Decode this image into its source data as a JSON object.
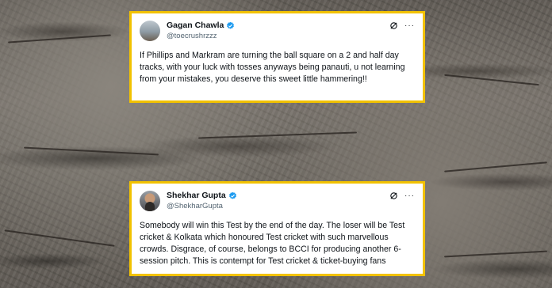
{
  "tweets": [
    {
      "name": "Gagan Chawla",
      "handle": "@toecrushrzzz",
      "text": "If Phillips and Markram are turning the ball square on a 2 and half day tracks, with your luck with tosses anyways being panauti, u not learning from your mistakes, you deserve this sweet little hammering!!"
    },
    {
      "name": "Shekhar Gupta",
      "handle": "@ShekharGupta",
      "text": "Somebody will win this Test by the end of the day. The loser will be Test cricket & Kolkata which honoured Test cricket with such marvellous crowds. Disgrace, of course, belongs to BCCI for producing another 6-session pitch. This is contempt for Test cricket & ticket-buying fans"
    }
  ],
  "icons": {
    "verified": "verified-badge-icon",
    "grok": "grok-icon",
    "more": "more-icon"
  },
  "colors": {
    "card_border": "#f2c200",
    "verified_blue": "#1d9bf0",
    "handle_gray": "#536471"
  }
}
